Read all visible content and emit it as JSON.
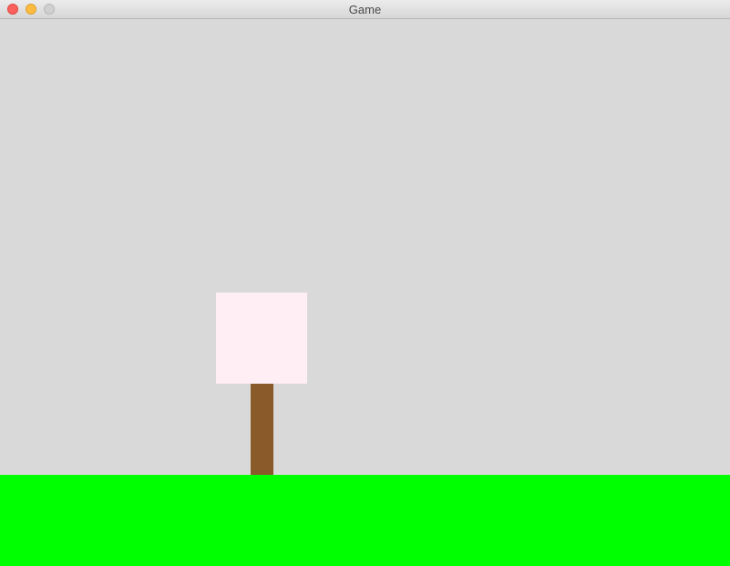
{
  "window": {
    "title": "Game",
    "controls": {
      "close_icon": "close-circle",
      "minimize_icon": "minimize-circle",
      "zoom_icon": "zoom-circle"
    }
  },
  "scene": {
    "background_color": "#d9d9d9",
    "ground_color": "#00ff00",
    "tree": {
      "trunk_color": "#8b5a2b",
      "canopy_color": "#ffeef3"
    }
  }
}
